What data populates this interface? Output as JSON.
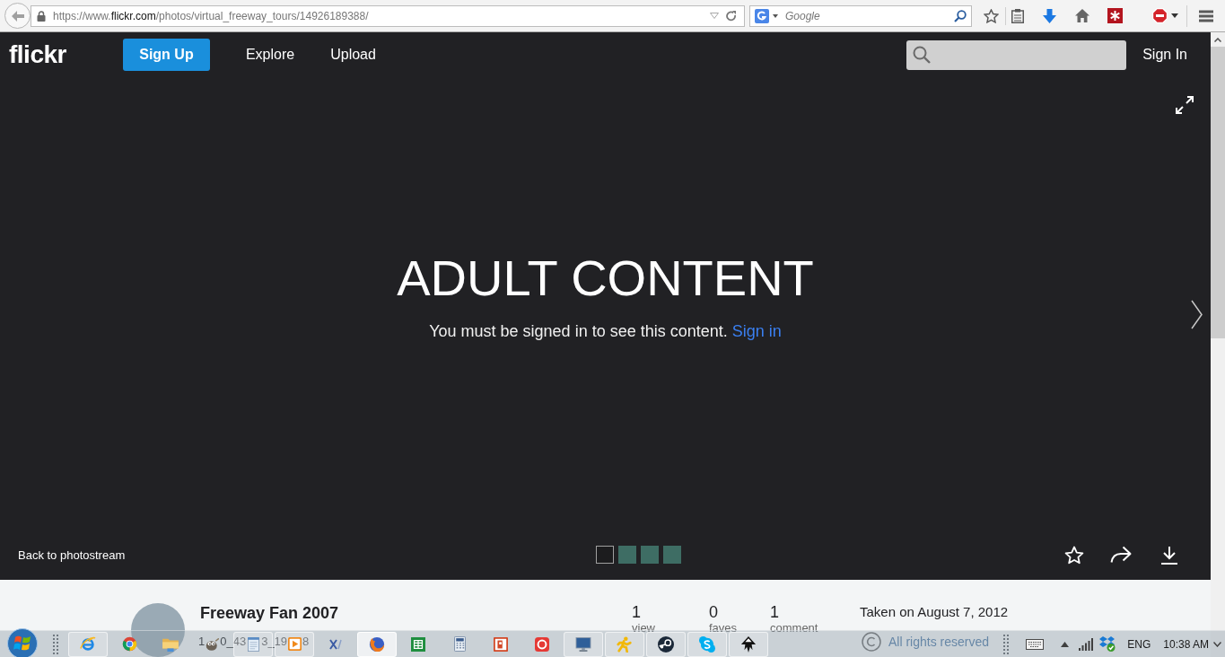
{
  "browser": {
    "url": {
      "scheme": "https://www.",
      "domain": "flickr.com",
      "path": "/photos/virtual_freeway_tours/14926189388/"
    },
    "search": {
      "placeholder": "Google"
    }
  },
  "nav": {
    "logo": "flickr",
    "signup": "Sign Up",
    "links": [
      "Explore",
      "Upload"
    ],
    "signin": "Sign In"
  },
  "viewer": {
    "heading": "ADULT CONTENT",
    "message": "You must be signed in to see this content.",
    "message_link": "Sign in",
    "back_link": "Back to photostream",
    "thumbnails": [
      {
        "selected": true
      },
      {
        "selected": false
      },
      {
        "selected": false
      },
      {
        "selected": false
      }
    ]
  },
  "info": {
    "owner": "Freeway Fan 2007",
    "title_fragments": [
      "1",
      "0_43",
      "3_19",
      "8"
    ],
    "stats": [
      {
        "value": "1",
        "label": "view"
      },
      {
        "value": "0",
        "label": "faves"
      },
      {
        "value": "1",
        "label": "comment"
      }
    ],
    "taken": "Taken on August 7, 2012",
    "license": "All rights reserved"
  },
  "taskbar": {
    "buttons": [
      {
        "running": true,
        "selected": false
      },
      {
        "running": false,
        "selected": false
      },
      {
        "running": false,
        "selected": false
      },
      {
        "running": false,
        "selected": false
      },
      {
        "running": true,
        "selected": false
      },
      {
        "running": true,
        "selected": false
      },
      {
        "running": false,
        "selected": false
      },
      {
        "running": true,
        "selected": true
      },
      {
        "running": false,
        "selected": false
      },
      {
        "running": false,
        "selected": false
      },
      {
        "running": false,
        "selected": false
      },
      {
        "running": false,
        "selected": false
      },
      {
        "running": true,
        "selected": false
      },
      {
        "running": true,
        "selected": false
      },
      {
        "running": true,
        "selected": false
      },
      {
        "running": true,
        "selected": false
      },
      {
        "running": true,
        "selected": false
      }
    ],
    "language": "ENG",
    "time": "10:38 AM"
  }
}
